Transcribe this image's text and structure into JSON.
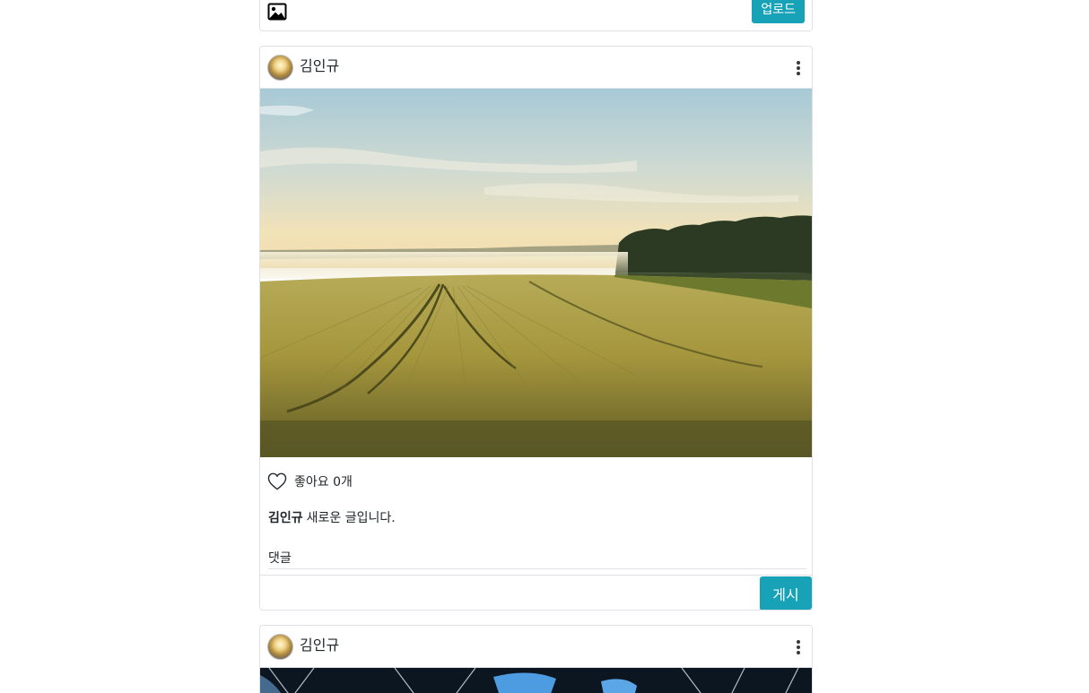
{
  "upload": {
    "image_icon": "image-icon",
    "upload_label": "업로드"
  },
  "posts": [
    {
      "username": "김인규",
      "image": "wheat-field-landscape",
      "like_text": "좋아요 0개",
      "caption_user": "김인규",
      "caption_text": "새로운 글입니다.",
      "comment_label": "댓글",
      "comment_value": "",
      "post_label": "게시"
    },
    {
      "username": "김인규",
      "image": "palm-trees-sky"
    }
  ],
  "colors": {
    "accent": "#17a2b8",
    "border": "#dee2e6",
    "text": "#212529"
  }
}
